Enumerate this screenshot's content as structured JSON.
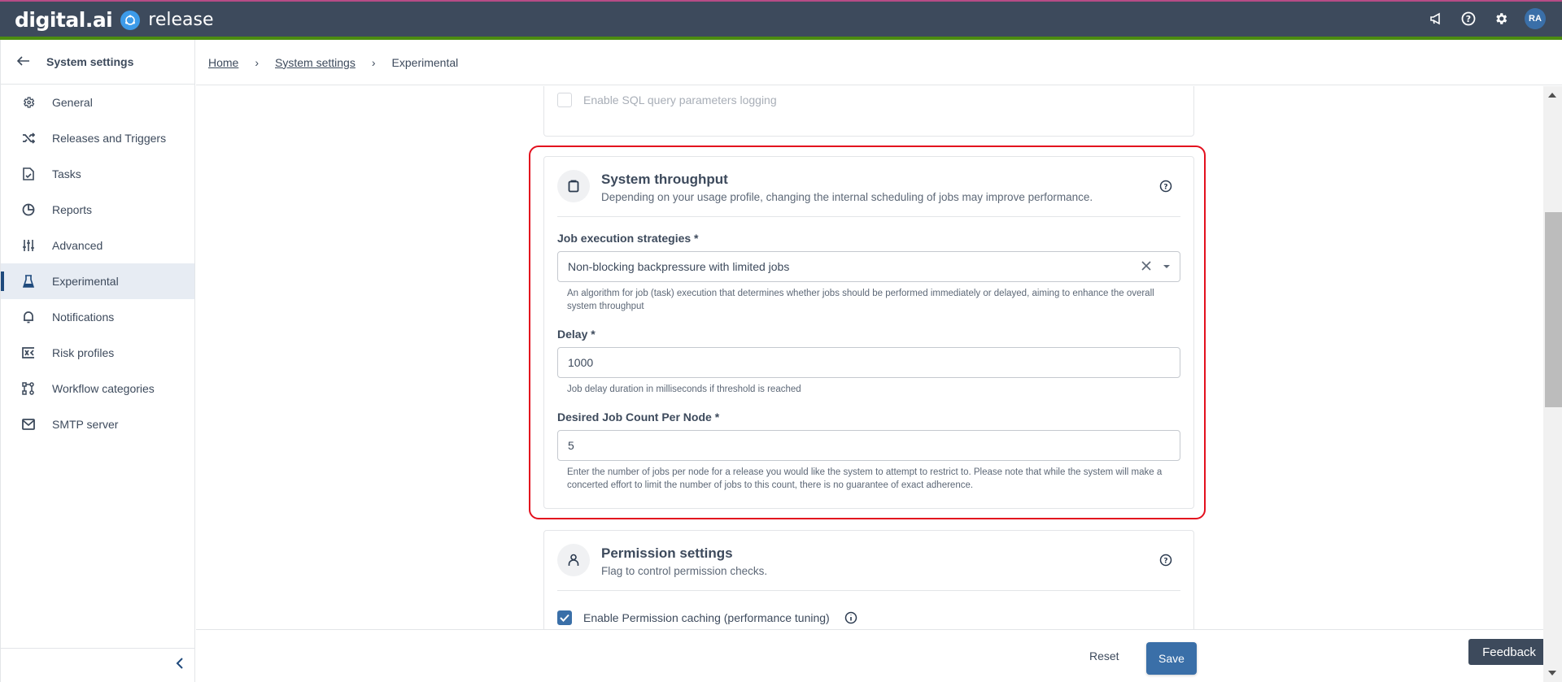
{
  "app": {
    "brand": "digital.ai",
    "product": "release",
    "user_initials": "RA",
    "colors": {
      "topbar": "#3d4a5c",
      "accent_green": "#4c8c10",
      "primary": "#3a6fa8",
      "highlight": "#e3101e"
    }
  },
  "topbar": {
    "icons": [
      "megaphone-icon",
      "help-icon",
      "gear-icon",
      "avatar"
    ]
  },
  "sidebar": {
    "title": "System settings",
    "back_icon": "arrow-left-icon",
    "items": [
      {
        "label": "General",
        "icon": "gear-icon",
        "active": false
      },
      {
        "label": "Releases and Triggers",
        "icon": "shuffle-icon",
        "active": false
      },
      {
        "label": "Tasks",
        "icon": "file-check-icon",
        "active": false
      },
      {
        "label": "Reports",
        "icon": "pie-chart-icon",
        "active": false
      },
      {
        "label": "Advanced",
        "icon": "sliders-icon",
        "active": false
      },
      {
        "label": "Experimental",
        "icon": "flask-icon",
        "active": true
      },
      {
        "label": "Notifications",
        "icon": "bell-icon",
        "active": false
      },
      {
        "label": "Risk profiles",
        "icon": "risk-icon",
        "active": false
      },
      {
        "label": "Workflow categories",
        "icon": "workflow-icon",
        "active": false
      },
      {
        "label": "SMTP server",
        "icon": "mail-icon",
        "active": false
      }
    ],
    "collapse_icon": "chevron-left-icon"
  },
  "breadcrumb": {
    "items": [
      {
        "label": "Home",
        "link": true
      },
      {
        "label": "System settings",
        "link": true
      },
      {
        "label": "Experimental",
        "link": false
      }
    ]
  },
  "sections": {
    "sql_logging": {
      "checkbox_label": "Enable SQL query parameters logging",
      "checked": false,
      "disabled": true
    },
    "throughput": {
      "title": "System throughput",
      "description": "Depending on your usage profile, changing the internal scheduling of jobs may improve performance.",
      "icon": "clipboard-icon",
      "fields": {
        "strategy": {
          "label": "Job execution strategies *",
          "value": "Non-blocking backpressure with limited jobs",
          "help": "An algorithm for job (task) execution that determines whether jobs should be performed immediately or delayed, aiming to enhance the overall system throughput"
        },
        "delay": {
          "label": "Delay *",
          "value": "1000",
          "help": "Job delay duration in milliseconds if threshold is reached"
        },
        "job_count": {
          "label": "Desired Job Count Per Node *",
          "value": "5",
          "help": "Enter the number of jobs per node for a release you would like the system to attempt to restrict to. Please note that while the system will make a concerted effort to limit the number of jobs to this count, there is no guarantee of exact adherence."
        }
      }
    },
    "permission": {
      "title": "Permission settings",
      "description": "Flag to control permission checks.",
      "icon": "user-icon",
      "checkbox_label": "Enable Permission caching (performance tuning)",
      "checked": true
    }
  },
  "actions": {
    "reset_label": "Reset",
    "save_label": "Save",
    "feedback_label": "Feedback"
  }
}
